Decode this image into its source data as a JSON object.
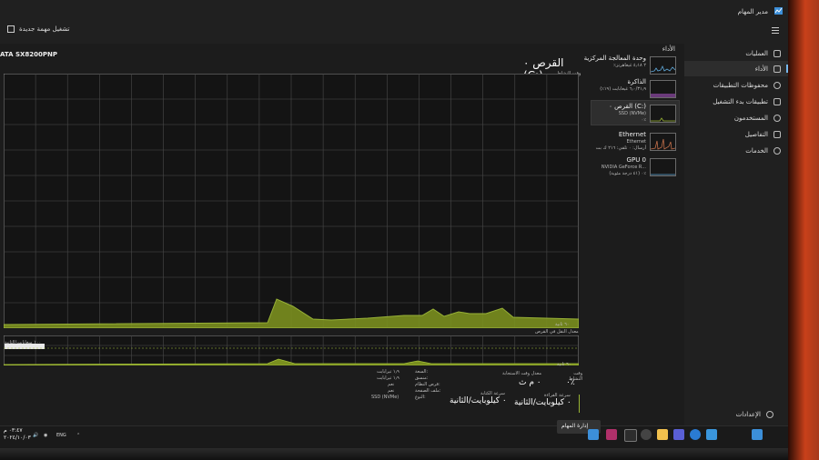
{
  "window": {
    "title": "مدير المهام"
  },
  "toolbar": {
    "run_new_task": "تشغيل مهمة جديدة"
  },
  "nav": {
    "items": [
      {
        "label": "العمليات",
        "icon": "processes-icon"
      },
      {
        "label": "الأداء",
        "icon": "performance-icon",
        "active": true
      },
      {
        "label": "محفوظات التطبيقات",
        "icon": "history-icon"
      },
      {
        "label": "تطبيقات بدء التشغيل",
        "icon": "startup-icon"
      },
      {
        "label": "المستخدمون",
        "icon": "users-icon"
      },
      {
        "label": "التفاصيل",
        "icon": "details-icon"
      },
      {
        "label": "الخدمات",
        "icon": "services-icon"
      }
    ],
    "settings": "الإعدادات"
  },
  "perf_list": {
    "header": "الأداء",
    "items": [
      {
        "name": "وحدة المعالجة المركزية",
        "sub": "٪٢ ٤٫١٨ غيغاهرتز",
        "value": ""
      },
      {
        "name": "الذاكرة",
        "sub": "٦٫٠/٣١٫٩ غيغابايت (١٩٪)",
        "value": ""
      },
      {
        "name": "القرص ٠ (C:)",
        "sub": "SSD (NVMe)",
        "value": "٠٪",
        "selected": true
      },
      {
        "name": "Ethernet",
        "sub": "Ethernet",
        "value": "أرسال: ٠ تلقي: ٢١٦ ك بت"
      },
      {
        "name": "GPU 0",
        "sub": "NVIDIA GeForce R...",
        "value": "(٤١ درجة مئوية) ٠٪"
      }
    ]
  },
  "main": {
    "model": "ATA SX8200PNP",
    "disk_title": "القرص ٠ (C:)",
    "active_time_label": "وقت النشاط",
    "graph1_axis": "٦٠ ثانية",
    "graph2_label": "معدل النقل في القرص",
    "graph2_scale": "١٠٠ ميغابايت/الثانية",
    "graph2_axis": "٦٠ ثانية"
  },
  "stats": {
    "active_time_label": "وقت النشاط",
    "active_time_value": "٠٪",
    "response_label": "معدل وقت الاستجابة",
    "response_value": "٠ م ث",
    "read_label": "سرعة القراءة",
    "read_value": "٠ كيلوبايت/الثانية",
    "write_label": "سرعة الكتابة",
    "write_value": "٠ كيلوبايت/الثانية",
    "capacity_label": "السعة:",
    "capacity_value": "١٫٩ تيرابايت",
    "formatted_label": "منسق:",
    "formatted_value": "١٫٩ تيرابايت",
    "system_disk_label": "قرص النظام:",
    "system_disk_value": "نعم",
    "page_file_label": "ملف الصفحة:",
    "page_file_value": "نعم",
    "type_label": "النوع:",
    "type_value": "SSD (NVMe)"
  },
  "taskbar": {
    "active_app": "إدارة المهام",
    "clock_time": "٠٣:٤٧ م",
    "clock_date": "٢٠٢٤/١٠/٠٣",
    "lang": "ENG"
  },
  "colors": {
    "accent_green": "#9ab534",
    "selected_blue": "#76b9ed"
  }
}
